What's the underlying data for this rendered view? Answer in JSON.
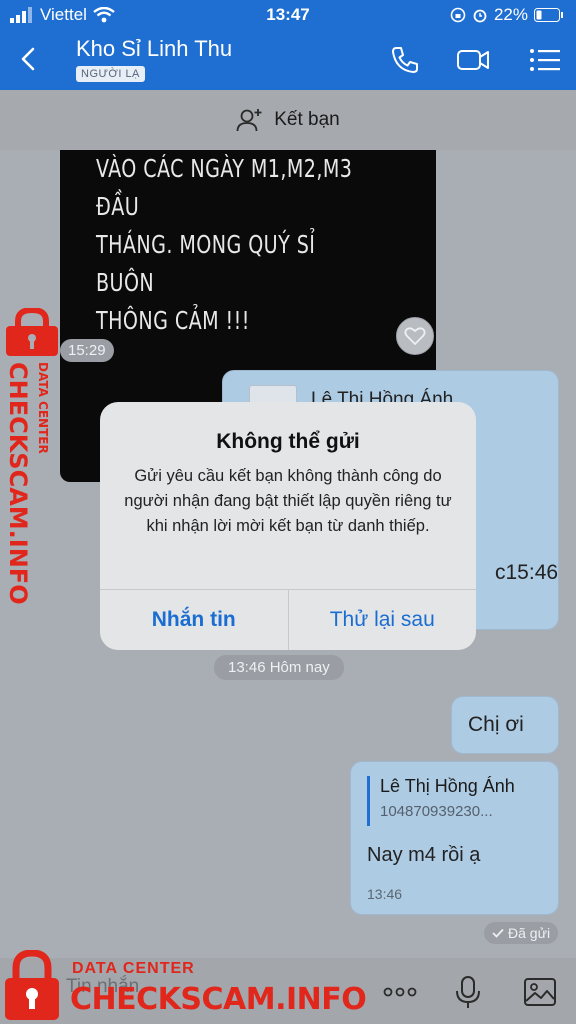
{
  "status_bar": {
    "carrier": "Viettel",
    "time": "13:47",
    "battery": "22%"
  },
  "header": {
    "title": "Kho Sỉ Linh Thu",
    "badge": "NGƯỜI LẠ",
    "icons": [
      "back-chevron-icon",
      "phone-icon",
      "video-camera-icon",
      "menu-list-icon"
    ]
  },
  "add_friend": {
    "label": "Kết bạn"
  },
  "messages": {
    "image_text": "VÀO CÁC NGÀY M1,M2,M3 ĐẦU\nTHÁNG. MONG QUÝ SỈ BUÔN\nTHÔNG CẢM !!!",
    "image_time": "15:29",
    "contact_card_name": "Lê Thị Hồng Ánh",
    "contact_card_tail": "c15:46",
    "date_divider": "13:46 Hôm nay",
    "msg1": "Chị ơi",
    "reply_name": "Lê Thị Hồng Ánh",
    "reply_number": "104870939230...",
    "reply_text": "Nay m4 rồi ạ",
    "reply_time": "13:46",
    "sent_status": "Đã gửi"
  },
  "dialog": {
    "title": "Không thể gửi",
    "body": "Gửi yêu cầu kết bạn không thành công do người nhận đang bật thiết lập quyền riêng tư khi nhận lời mời kết bạn từ danh thiếp.",
    "btn_primary": "Nhắn tin",
    "btn_secondary": "Thử lại sau"
  },
  "input": {
    "placeholder": "Tin nhắn"
  },
  "watermark": {
    "line1": "DATA CENTER",
    "line2": "CHECKSCAM.INFO"
  },
  "colors": {
    "header": "#1f6fd2",
    "bubble": "#aecbe4",
    "watermark": "#e1261c",
    "dialog_button": "#1a6ed1"
  }
}
